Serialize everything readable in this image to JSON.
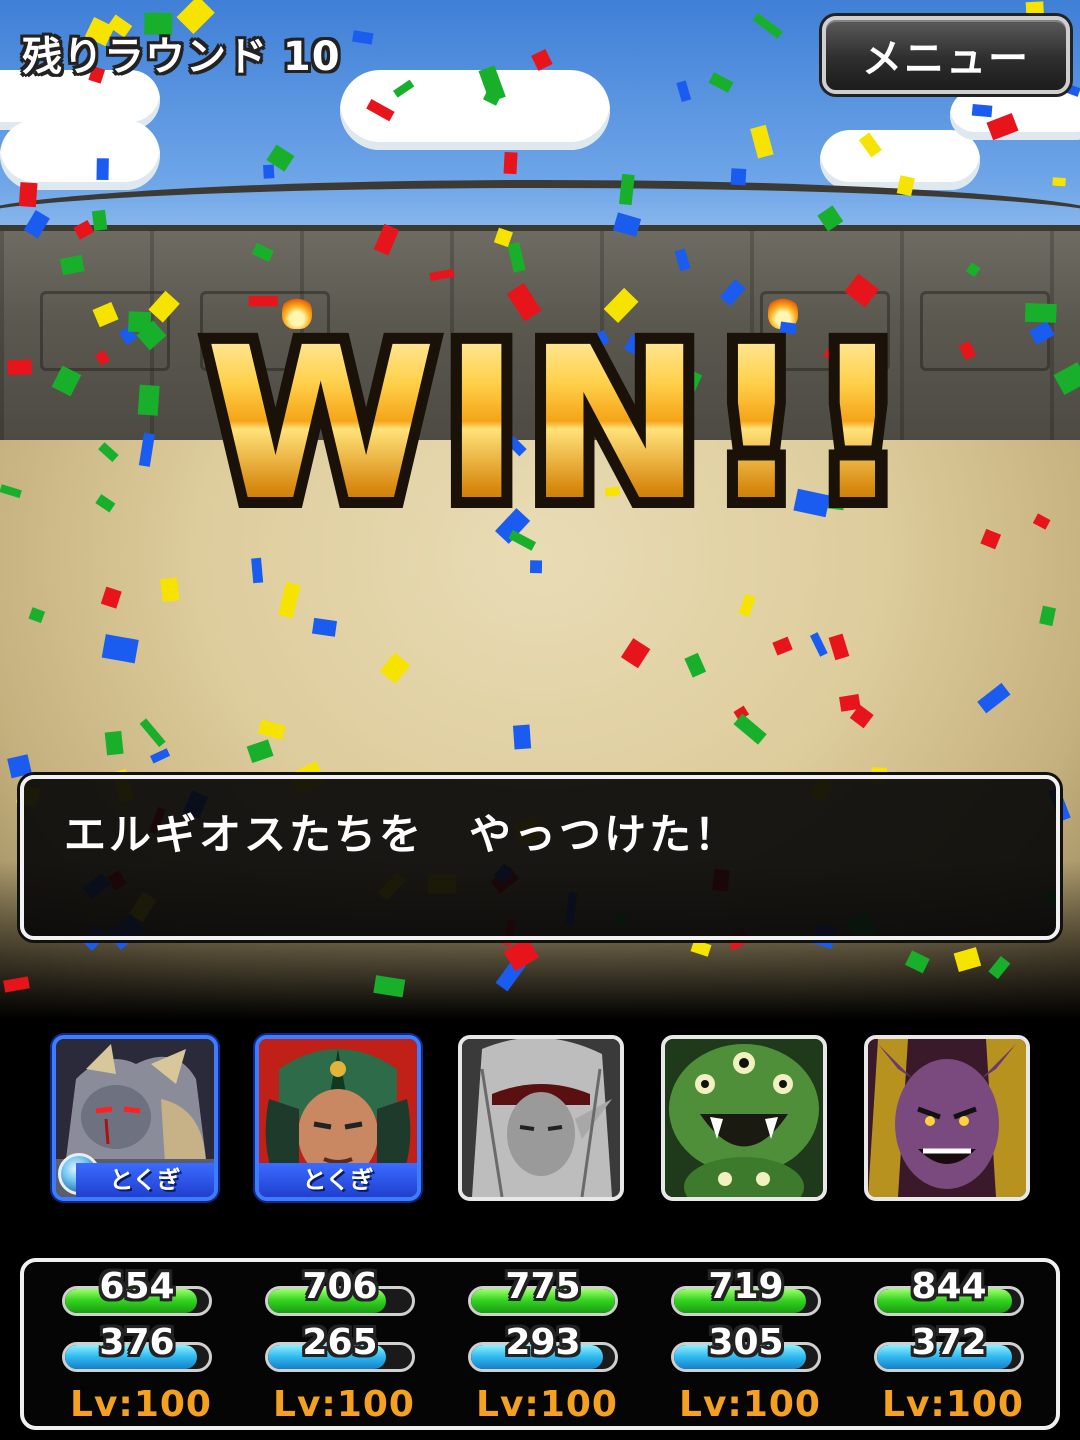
{
  "hud": {
    "round_label": "残りラウンド 10",
    "menu_label": "メニュー"
  },
  "banner": {
    "text": "WIN!!"
  },
  "message": {
    "text": "エルギオスたちを　やっつけた！"
  },
  "party": [
    {
      "portrait": "silver-armored-demon-portrait",
      "tag": "とくぎ",
      "has_gem": true,
      "frame": "blue",
      "hp": "654",
      "hp_fill": 0.92,
      "mp": "376",
      "mp_fill": 0.92,
      "level": "Lv:100"
    },
    {
      "portrait": "green-helmet-warrior-portrait",
      "tag": "とくぎ",
      "has_gem": false,
      "frame": "blue",
      "hp": "706",
      "hp_fill": 0.82,
      "mp": "265",
      "mp_fill": 0.82,
      "level": "Lv:100"
    },
    {
      "portrait": "white-haired-elf-portrait",
      "tag": "",
      "has_gem": false,
      "frame": "white",
      "hp": "775",
      "hp_fill": 1.0,
      "mp": "293",
      "mp_fill": 0.92,
      "level": "Lv:100"
    },
    {
      "portrait": "green-multi-eyed-monster-portrait",
      "tag": "",
      "has_gem": false,
      "frame": "white",
      "hp": "719",
      "hp_fill": 0.92,
      "mp": "305",
      "mp_fill": 0.92,
      "level": "Lv:100"
    },
    {
      "portrait": "purple-demon-portrait",
      "tag": "",
      "has_gem": false,
      "frame": "white",
      "hp": "844",
      "hp_fill": 0.94,
      "mp": "372",
      "mp_fill": 0.94,
      "level": "Lv:100"
    }
  ],
  "colors": {
    "win_gold": "#f5a417",
    "hp_green": "#31d11f",
    "mp_blue": "#2fb9f0",
    "level_orange": "#f4a020",
    "skill_tag_blue": "#1f3fcf"
  }
}
